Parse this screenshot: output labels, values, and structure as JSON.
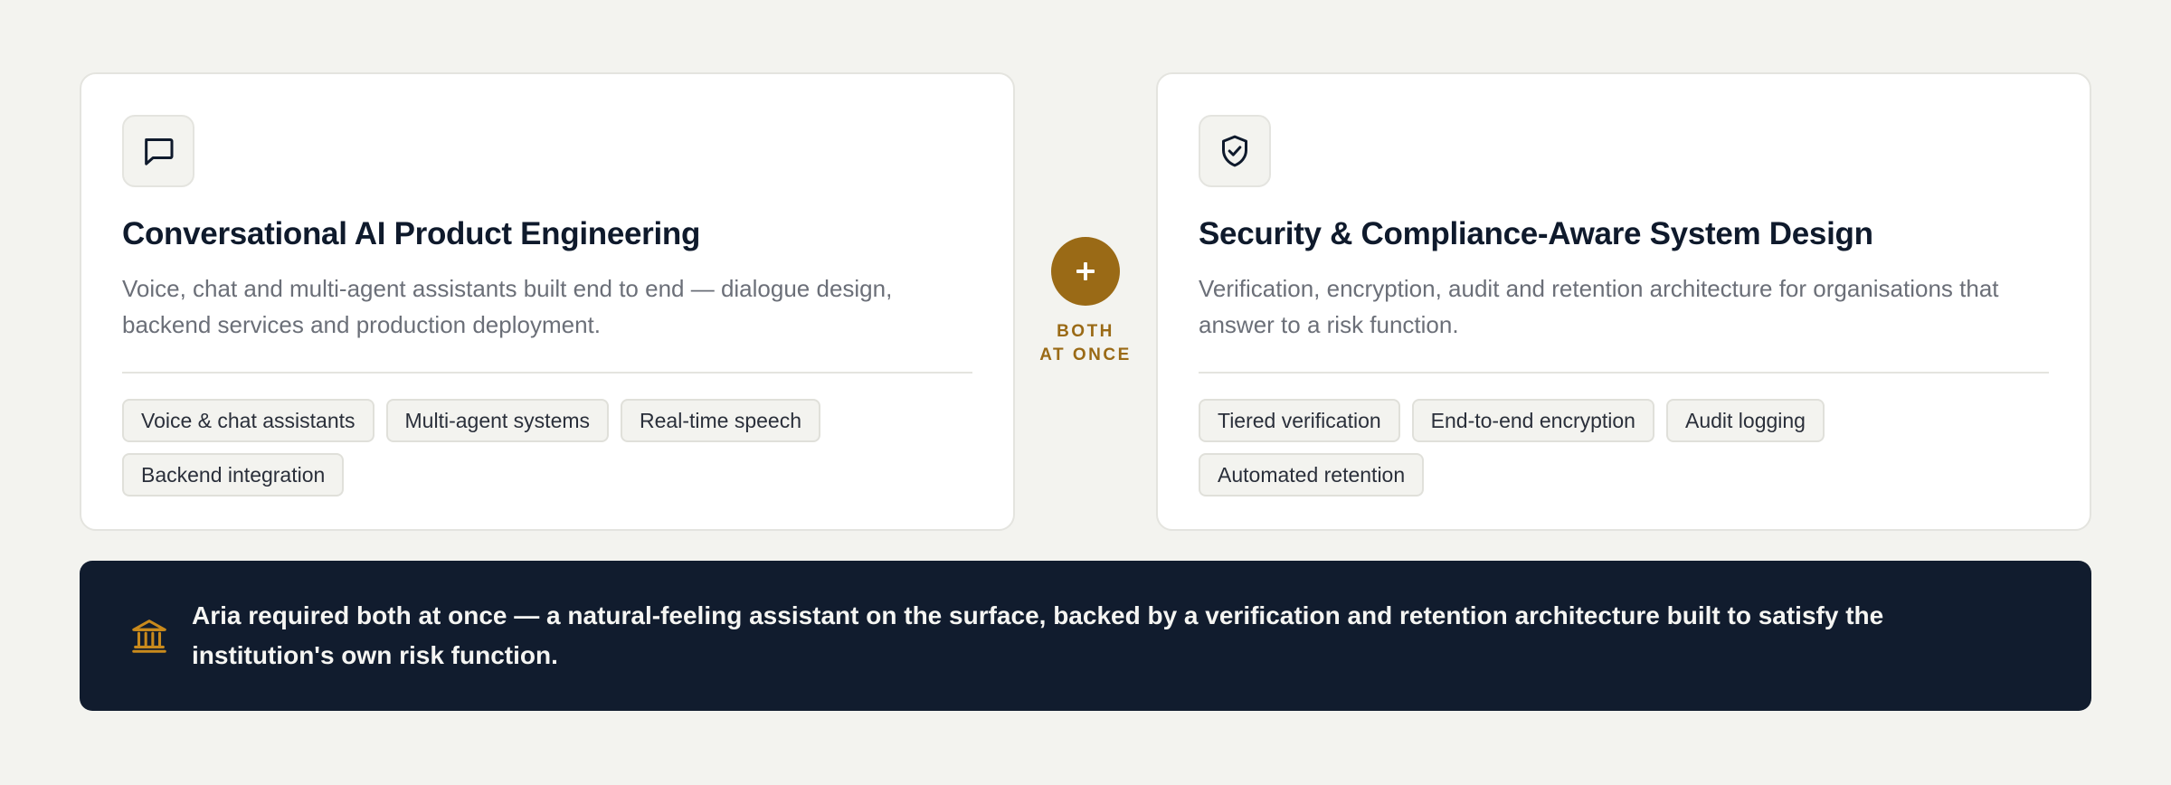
{
  "cards": [
    {
      "icon": "chat-bubble-icon",
      "title": "Conversational AI Product Engineering",
      "description": "Voice, chat and multi-agent assistants built end to end — dialogue design, backend services and production deployment.",
      "tags": [
        "Voice & chat assistants",
        "Multi-agent systems",
        "Real-time speech",
        "Backend integration"
      ]
    },
    {
      "icon": "shield-check-icon",
      "title": "Security & Compliance-Aware System Design",
      "description": "Verification, encryption, audit and retention architecture for organisations that answer to a risk function.",
      "tags": [
        "Tiered verification",
        "End-to-end encryption",
        "Audit logging",
        "Automated retention"
      ]
    }
  ],
  "connector": {
    "symbol": "+",
    "label_line1": "BOTH",
    "label_line2": "AT ONCE"
  },
  "banner": {
    "icon": "institution-icon",
    "text": "Aria required both at once — a natural-feeling assistant on the surface, backed by a verification and retention architecture built to satisfy the institution's own risk function."
  },
  "colors": {
    "accent": "#9a6a16",
    "banner_bg": "#111c2e",
    "page_bg": "#f3f3ef",
    "title": "#0f1a2c",
    "muted_text": "#6b6f78"
  }
}
